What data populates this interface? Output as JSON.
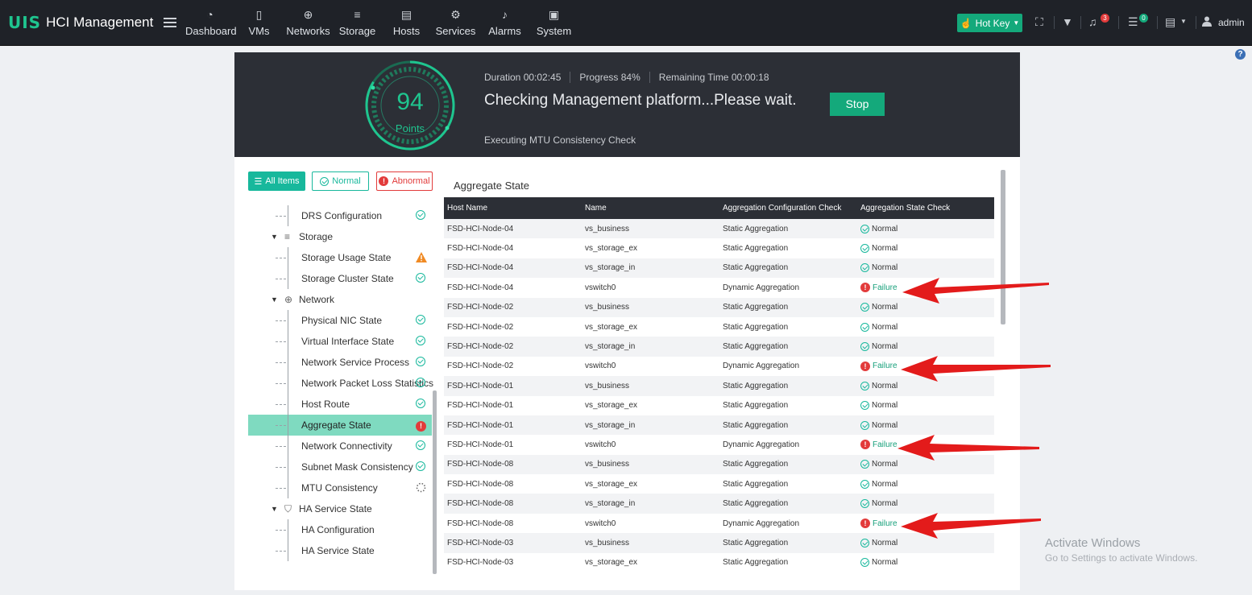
{
  "app": {
    "logo": "UIS",
    "title": "HCI Management"
  },
  "nav": [
    {
      "label": "Dashboard",
      "icon": "dashboard-icon"
    },
    {
      "label": "VMs",
      "icon": "vm-icon"
    },
    {
      "label": "Networks",
      "icon": "globe-icon"
    },
    {
      "label": "Storage",
      "icon": "database-icon"
    },
    {
      "label": "Hosts",
      "icon": "server-icon"
    },
    {
      "label": "Services",
      "icon": "gear-icon"
    },
    {
      "label": "Alarms",
      "icon": "bell-icon"
    },
    {
      "label": "System",
      "icon": "monitor-icon"
    }
  ],
  "toolbar": {
    "hotkey_label": "Hot Key",
    "alarm_count": "3",
    "task_count": "0",
    "user": "admin"
  },
  "check": {
    "score": "94",
    "score_unit": "Points",
    "duration": "Duration 00:02:45",
    "progress": "Progress 84%",
    "remaining": "Remaining Time 00:00:18",
    "status": "Checking Management platform...Please wait.",
    "stop_label": "Stop",
    "executing": "Executing MTU Consistency Check",
    "progress_value": 84
  },
  "filters": {
    "all": "All Items",
    "normal": "Normal",
    "abnormal": "Abnormal"
  },
  "tree": [
    {
      "type": "leaf",
      "label": "DRS Configuration",
      "status": "ok"
    },
    {
      "type": "group",
      "label": "Storage",
      "icon": "storage-icon"
    },
    {
      "type": "leaf",
      "label": "Storage Usage State",
      "status": "warn"
    },
    {
      "type": "leaf",
      "label": "Storage Cluster State",
      "status": "ok"
    },
    {
      "type": "group",
      "label": "Network",
      "icon": "globe-icon"
    },
    {
      "type": "leaf",
      "label": "Physical NIC State",
      "status": "ok"
    },
    {
      "type": "leaf",
      "label": "Virtual Interface State",
      "status": "ok"
    },
    {
      "type": "leaf",
      "label": "Network Service Process",
      "status": "ok"
    },
    {
      "type": "leaf",
      "label": "Network Packet Loss Statistics",
      "status": "ok"
    },
    {
      "type": "leaf",
      "label": "Host Route",
      "status": "ok"
    },
    {
      "type": "leaf",
      "label": "Aggregate State",
      "status": "error",
      "selected": true
    },
    {
      "type": "leaf",
      "label": "Network Connectivity",
      "status": "ok"
    },
    {
      "type": "leaf",
      "label": "Subnet Mask Consistency",
      "status": "ok"
    },
    {
      "type": "leaf",
      "label": "MTU Consistency",
      "status": "loading"
    },
    {
      "type": "group",
      "label": "HA Service State",
      "icon": "shield-icon"
    },
    {
      "type": "leaf",
      "label": "HA Configuration",
      "status": ""
    },
    {
      "type": "leaf",
      "label": "HA Service State",
      "status": ""
    }
  ],
  "table": {
    "title": "Aggregate State",
    "headers": [
      "Host Name",
      "Name",
      "Aggregation Configuration Check",
      "Aggregation State Check"
    ],
    "rows": [
      [
        "FSD-HCI-Node-04",
        "vs_business",
        "Static Aggregation",
        "Normal"
      ],
      [
        "FSD-HCI-Node-04",
        "vs_storage_ex",
        "Static Aggregation",
        "Normal"
      ],
      [
        "FSD-HCI-Node-04",
        "vs_storage_in",
        "Static Aggregation",
        "Normal"
      ],
      [
        "FSD-HCI-Node-04",
        "vswitch0",
        "Dynamic Aggregation",
        "Failure"
      ],
      [
        "FSD-HCI-Node-02",
        "vs_business",
        "Static Aggregation",
        "Normal"
      ],
      [
        "FSD-HCI-Node-02",
        "vs_storage_ex",
        "Static Aggregation",
        "Normal"
      ],
      [
        "FSD-HCI-Node-02",
        "vs_storage_in",
        "Static Aggregation",
        "Normal"
      ],
      [
        "FSD-HCI-Node-02",
        "vswitch0",
        "Dynamic Aggregation",
        "Failure"
      ],
      [
        "FSD-HCI-Node-01",
        "vs_business",
        "Static Aggregation",
        "Normal"
      ],
      [
        "FSD-HCI-Node-01",
        "vs_storage_ex",
        "Static Aggregation",
        "Normal"
      ],
      [
        "FSD-HCI-Node-01",
        "vs_storage_in",
        "Static Aggregation",
        "Normal"
      ],
      [
        "FSD-HCI-Node-01",
        "vswitch0",
        "Dynamic Aggregation",
        "Failure"
      ],
      [
        "FSD-HCI-Node-08",
        "vs_business",
        "Static Aggregation",
        "Normal"
      ],
      [
        "FSD-HCI-Node-08",
        "vs_storage_ex",
        "Static Aggregation",
        "Normal"
      ],
      [
        "FSD-HCI-Node-08",
        "vs_storage_in",
        "Static Aggregation",
        "Normal"
      ],
      [
        "FSD-HCI-Node-08",
        "vswitch0",
        "Dynamic Aggregation",
        "Failure"
      ],
      [
        "FSD-HCI-Node-03",
        "vs_business",
        "Static Aggregation",
        "Normal"
      ],
      [
        "FSD-HCI-Node-03",
        "vs_storage_ex",
        "Static Aggregation",
        "Normal"
      ]
    ]
  },
  "watermark": {
    "line1": "Activate Windows",
    "line2": "Go to Settings to activate Windows."
  },
  "colors": {
    "accent": "#14a97b",
    "error": "#e23b3b",
    "warning": "#f08a24",
    "banner": "#2c2f36"
  }
}
